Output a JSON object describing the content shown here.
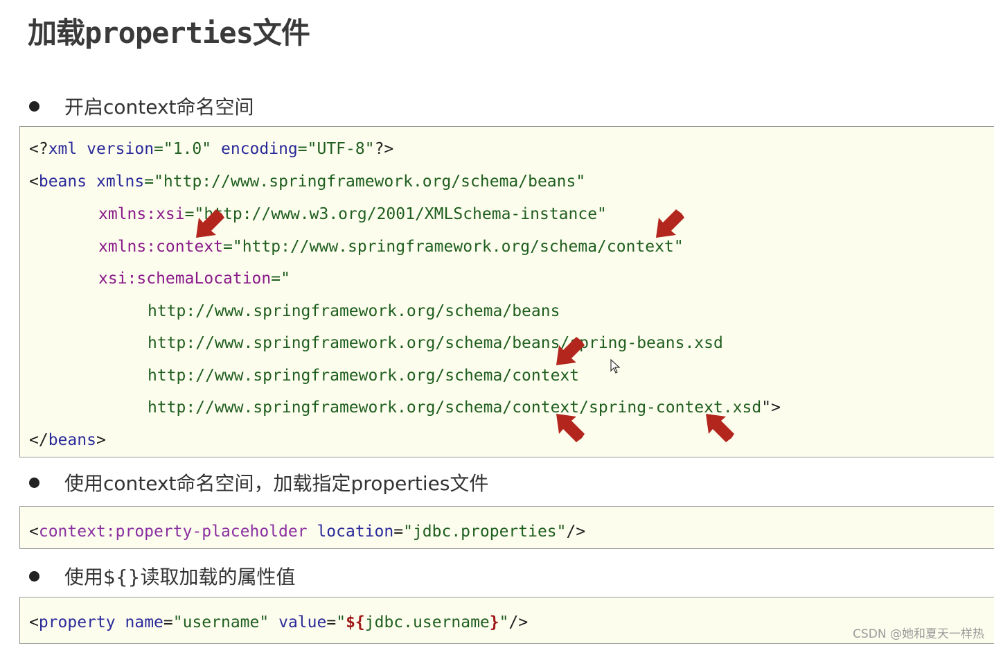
{
  "title": "加载properties文件",
  "bullets": [
    "开启context命名空间",
    "使用context命名空间，加载指定properties文件",
    "使用${}读取加载的属性值"
  ],
  "code1": {
    "l1": [
      "<?",
      "xml",
      " ",
      "version",
      "=\"1.0\"",
      " ",
      "encoding",
      "=\"UTF-8\"",
      "?>"
    ],
    "l2": [
      "<",
      "beans",
      " ",
      "xmlns",
      "=\"http://www.springframework.org/schema/beans\""
    ],
    "l3": [
      "xmlns:xsi",
      "=\"http://www.w3.org/2001/XMLSchema-instance\""
    ],
    "l4": [
      "xmlns:context",
      "=\"http://www.springframework.org/schema/context\""
    ],
    "l5": [
      "xsi:schemaLocation",
      "=\""
    ],
    "l6": "http://www.springframework.org/schema/beans",
    "l7": "http://www.springframework.org/schema/beans/spring-beans.xsd",
    "l8": "http://www.springframework.org/schema/context",
    "l9": [
      "http://www.springframework.org/schema/context/spring-context.xsd",
      "\">"
    ],
    "l10": [
      "</",
      "beans",
      ">"
    ]
  },
  "code2": [
    "<",
    "context:property-placeholder",
    " ",
    "location",
    "=",
    "\"jdbc.properties\"",
    "/>"
  ],
  "code3": [
    "<",
    "property",
    " ",
    "name",
    "=",
    "\"username\"",
    " ",
    "value",
    "=",
    "\"",
    "${",
    "jdbc.username",
    "}",
    "\"",
    "/>"
  ],
  "watermark": "CSDN @她和夏天一样热",
  "colors": {
    "arrow": "#b3261e",
    "code_bg": "#fdfdee"
  }
}
